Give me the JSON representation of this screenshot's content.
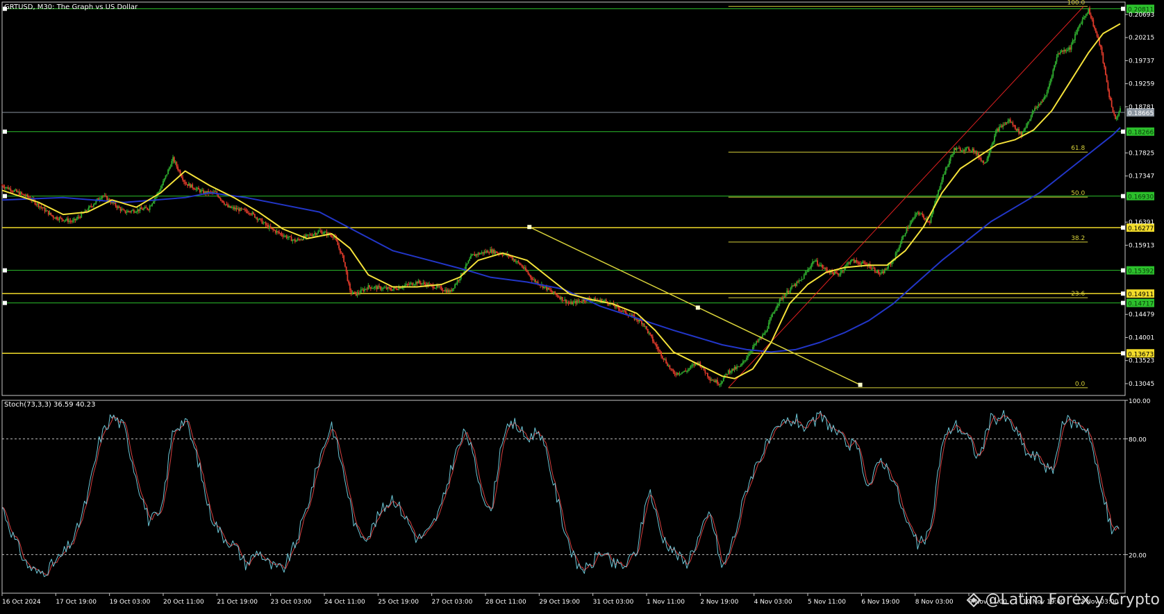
{
  "window_title": "GRTUSD, M30:  The Graph vs US Dollar",
  "stoch_title": "Stoch(73,3,3) 36.59 40.23",
  "watermark": "@Latim Forex y Crypto",
  "colors": {
    "background": "#000000",
    "frame": "#c8c8c8",
    "candle_up": "#2fae2f",
    "candle_down": "#e23b2b",
    "ma_fast": "#f5e23a",
    "ma_slow": "#2236c8",
    "level_green": "#2cc02c",
    "level_yellow": "#f2dc2a",
    "bid_line": "#8c96a0",
    "fib": "#d8d23a",
    "fib_trend": "#e02020",
    "trendline": "#d8d23a",
    "stoch_main": "#6cc8d8",
    "stoch_signal": "#d84040"
  },
  "chart_data": [
    {
      "type": "candlestick",
      "symbol": "GRTUSD",
      "timeframe": "M30",
      "ylim": [
        0.128,
        0.2095
      ],
      "y_ticks": [
        "0.20693",
        "0.20215",
        "0.19737",
        "0.19259",
        "0.18781",
        "0.17825",
        "0.17347",
        "0.16391",
        "0.15913",
        "0.14479",
        "0.14001",
        "0.13523",
        "0.13045"
      ],
      "x_ticks": [
        "16 Oct 2024",
        "17 Oct 19:00",
        "19 Oct 03:00",
        "20 Oct 11:00",
        "21 Oct 19:00",
        "23 Oct 03:00",
        "24 Oct 11:00",
        "25 Oct 19:00",
        "27 Oct 03:00",
        "28 Oct 11:00",
        "29 Oct 19:00",
        "31 Oct 03:00",
        "1 Nov 11:00",
        "2 Nov 19:00",
        "4 Nov 03:00",
        "5 Nov 11:00",
        "6 Nov 19:00",
        "8 Nov 03:00",
        "9 Nov 11:00",
        "10 Nov 19:00",
        "12 Nov 03:00"
      ],
      "price_path": [
        [
          0,
          0.1715
        ],
        [
          2.2,
          0.169
        ],
        [
          4.2,
          0.165
        ],
        [
          5.8,
          0.164
        ],
        [
          6.8,
          0.166
        ],
        [
          8.2,
          0.1695
        ],
        [
          10,
          0.166
        ],
        [
          12,
          0.1668
        ],
        [
          13,
          0.171
        ],
        [
          14,
          0.177
        ],
        [
          15,
          0.172
        ],
        [
          16.5,
          0.17
        ],
        [
          17.5,
          0.17
        ],
        [
          18.5,
          0.167
        ],
        [
          20.3,
          0.166
        ],
        [
          22,
          0.1625
        ],
        [
          24,
          0.16
        ],
        [
          25,
          0.161
        ],
        [
          26,
          0.162
        ],
        [
          27.2,
          0.161
        ],
        [
          28,
          0.156
        ],
        [
          28.5,
          0.1495
        ],
        [
          29,
          0.149
        ],
        [
          30,
          0.1505
        ],
        [
          32,
          0.15
        ],
        [
          34,
          0.1515
        ],
        [
          35.5,
          0.1505
        ],
        [
          36.7,
          0.1495
        ],
        [
          37.5,
          0.1525
        ],
        [
          38.5,
          0.157
        ],
        [
          40,
          0.158
        ],
        [
          41.5,
          0.157
        ],
        [
          42.5,
          0.155
        ],
        [
          43.5,
          0.152
        ],
        [
          45,
          0.1495
        ],
        [
          46.5,
          0.147
        ],
        [
          48,
          0.148
        ],
        [
          49.5,
          0.1475
        ],
        [
          50.5,
          0.146
        ],
        [
          51.5,
          0.1445
        ],
        [
          52.5,
          0.143
        ],
        [
          53.5,
          0.1385
        ],
        [
          55,
          0.1325
        ],
        [
          56,
          0.133
        ],
        [
          57,
          0.135
        ],
        [
          58,
          0.1315
        ],
        [
          58.8,
          0.1305
        ],
        [
          59.5,
          0.133
        ],
        [
          60.5,
          0.134
        ],
        [
          61.5,
          0.138
        ],
        [
          62.5,
          0.141
        ],
        [
          63.5,
          0.147
        ],
        [
          64.5,
          0.15
        ],
        [
          65.5,
          0.152
        ],
        [
          66.5,
          0.156
        ],
        [
          67.5,
          0.154
        ],
        [
          68.5,
          0.153
        ],
        [
          69.5,
          0.156
        ],
        [
          71,
          0.155
        ],
        [
          72,
          0.153
        ],
        [
          73,
          0.156
        ],
        [
          74,
          0.162
        ],
        [
          75,
          0.166
        ],
        [
          76,
          0.164
        ],
        [
          77,
          0.173
        ],
        [
          78,
          0.179
        ],
        [
          79.5,
          0.179
        ],
        [
          80.5,
          0.176
        ],
        [
          81.5,
          0.183
        ],
        [
          82.5,
          0.185
        ],
        [
          83.5,
          0.182
        ],
        [
          84.5,
          0.187
        ],
        [
          85.5,
          0.19
        ],
        [
          86.5,
          0.199
        ],
        [
          87.5,
          0.2
        ],
        [
          88.3,
          0.205
        ],
        [
          89,
          0.208
        ],
        [
          90,
          0.2
        ],
        [
          90.7,
          0.19
        ],
        [
          91.2,
          0.185
        ],
        [
          91.6,
          0.1875
        ]
      ],
      "ma_fast": {
        "period": "fast",
        "path": [
          [
            0,
            0.1705
          ],
          [
            3,
            0.168
          ],
          [
            5,
            0.1655
          ],
          [
            7,
            0.166
          ],
          [
            9,
            0.1685
          ],
          [
            11,
            0.167
          ],
          [
            13,
            0.17
          ],
          [
            15,
            0.1745
          ],
          [
            17,
            0.1715
          ],
          [
            19,
            0.169
          ],
          [
            21,
            0.166
          ],
          [
            23,
            0.1625
          ],
          [
            25,
            0.1605
          ],
          [
            27,
            0.1615
          ],
          [
            28.5,
            0.1585
          ],
          [
            30,
            0.153
          ],
          [
            32,
            0.1505
          ],
          [
            34,
            0.1505
          ],
          [
            36,
            0.151
          ],
          [
            37.5,
            0.1525
          ],
          [
            39,
            0.156
          ],
          [
            41,
            0.1575
          ],
          [
            43,
            0.156
          ],
          [
            45,
            0.152
          ],
          [
            46.5,
            0.149
          ],
          [
            48,
            0.148
          ],
          [
            50,
            0.147
          ],
          [
            52,
            0.145
          ],
          [
            53.5,
            0.1415
          ],
          [
            55,
            0.137
          ],
          [
            57,
            0.1345
          ],
          [
            59,
            0.132
          ],
          [
            60,
            0.1315
          ],
          [
            61.5,
            0.1335
          ],
          [
            63,
            0.139
          ],
          [
            64.5,
            0.147
          ],
          [
            66,
            0.151
          ],
          [
            67.5,
            0.1535
          ],
          [
            69,
            0.1545
          ],
          [
            71,
            0.155
          ],
          [
            72.5,
            0.155
          ],
          [
            74,
            0.158
          ],
          [
            75.5,
            0.163
          ],
          [
            77,
            0.17
          ],
          [
            78.5,
            0.175
          ],
          [
            80,
            0.1775
          ],
          [
            81.5,
            0.18
          ],
          [
            83,
            0.181
          ],
          [
            84.5,
            0.183
          ],
          [
            86,
            0.187
          ],
          [
            87.5,
            0.193
          ],
          [
            89,
            0.199
          ],
          [
            90.2,
            0.203
          ],
          [
            91.6,
            0.205
          ]
        ]
      },
      "ma_slow": {
        "period": "slow",
        "path": [
          [
            0,
            0.1685
          ],
          [
            5,
            0.169
          ],
          [
            10,
            0.168
          ],
          [
            15,
            0.169
          ],
          [
            17,
            0.17
          ],
          [
            20,
            0.169
          ],
          [
            23,
            0.1675
          ],
          [
            26,
            0.166
          ],
          [
            29,
            0.162
          ],
          [
            32,
            0.158
          ],
          [
            35,
            0.156
          ],
          [
            38,
            0.154
          ],
          [
            40,
            0.1525
          ],
          [
            43,
            0.1515
          ],
          [
            46,
            0.15
          ],
          [
            49,
            0.1465
          ],
          [
            52,
            0.144
          ],
          [
            55,
            0.1415
          ],
          [
            57,
            0.14
          ],
          [
            59,
            0.1385
          ],
          [
            61,
            0.1375
          ],
          [
            63,
            0.137
          ],
          [
            65,
            0.1375
          ],
          [
            67,
            0.139
          ],
          [
            69,
            0.141
          ],
          [
            71,
            0.1435
          ],
          [
            73,
            0.147
          ],
          [
            75,
            0.1515
          ],
          [
            77,
            0.156
          ],
          [
            79,
            0.16
          ],
          [
            81,
            0.164
          ],
          [
            83,
            0.167
          ],
          [
            85,
            0.17
          ],
          [
            87,
            0.174
          ],
          [
            89,
            0.178
          ],
          [
            91,
            0.182
          ],
          [
            91.6,
            0.1835
          ]
        ]
      },
      "horizontal_levels": [
        {
          "price": 0.20811,
          "label": "0.20811",
          "kind": "green"
        },
        {
          "price": 0.18266,
          "label": "0.18266",
          "kind": "green"
        },
        {
          "price": 0.1693,
          "label": "0.16930",
          "kind": "green"
        },
        {
          "price": 0.16277,
          "label": "0.16277",
          "kind": "yellow"
        },
        {
          "price": 0.15392,
          "label": "0.15392",
          "kind": "green"
        },
        {
          "price": 0.14911,
          "label": "0.14911",
          "kind": "yellow"
        },
        {
          "price": 0.14717,
          "label": "0.14717",
          "kind": "green"
        },
        {
          "price": 0.13673,
          "label": "0.13673",
          "kind": "yellow"
        }
      ],
      "bid": {
        "price": 0.18665,
        "label": "0.18665"
      },
      "fibonacci": {
        "x_range": [
          59.5,
          88.6
        ],
        "low": 0.1296,
        "high": 0.2086,
        "levels": [
          {
            "ratio": 1.0,
            "label": "100.0"
          },
          {
            "ratio": 0.618,
            "label": "61.8"
          },
          {
            "ratio": 0.5,
            "label": "50.0"
          },
          {
            "ratio": 0.382,
            "label": "38.2"
          },
          {
            "ratio": 0.236,
            "label": "23.6"
          },
          {
            "ratio": 0.0,
            "label": "0.0"
          }
        ]
      },
      "trendline": {
        "from": [
          43.2,
          0.1629
        ],
        "mid": [
          57.0,
          0.1462
        ],
        "to": [
          70.3,
          0.1302
        ]
      }
    },
    {
      "type": "line",
      "indicator": "Stochastic",
      "params": "73,3,3",
      "main": 36.59,
      "signal": 40.23,
      "ylim": [
        0,
        100
      ],
      "y_ticks": [
        "100.00",
        "80.00",
        "20.00"
      ],
      "levels": [
        80,
        20
      ],
      "path": [
        [
          0,
          45
        ],
        [
          1,
          28
        ],
        [
          2,
          15
        ],
        [
          3,
          10
        ],
        [
          4,
          14
        ],
        [
          5,
          20
        ],
        [
          6,
          30
        ],
        [
          7,
          50
        ],
        [
          8,
          80
        ],
        [
          9,
          92
        ],
        [
          10,
          86
        ],
        [
          11,
          60
        ],
        [
          12,
          38
        ],
        [
          13,
          40
        ],
        [
          14,
          85
        ],
        [
          15,
          90
        ],
        [
          16,
          70
        ],
        [
          17,
          42
        ],
        [
          18,
          30
        ],
        [
          19,
          25
        ],
        [
          20,
          15
        ],
        [
          21,
          22
        ],
        [
          22,
          14
        ],
        [
          23,
          12
        ],
        [
          24,
          25
        ],
        [
          25,
          45
        ],
        [
          26,
          70
        ],
        [
          27,
          88
        ],
        [
          28,
          62
        ],
        [
          29,
          32
        ],
        [
          30,
          30
        ],
        [
          31,
          42
        ],
        [
          32,
          50
        ],
        [
          33,
          40
        ],
        [
          34,
          28
        ],
        [
          35,
          32
        ],
        [
          36,
          45
        ],
        [
          37,
          70
        ],
        [
          38,
          85
        ],
        [
          39,
          60
        ],
        [
          40,
          40
        ],
        [
          41,
          82
        ],
        [
          42,
          88
        ],
        [
          43,
          80
        ],
        [
          44,
          85
        ],
        [
          45,
          62
        ],
        [
          46,
          35
        ],
        [
          47,
          15
        ],
        [
          48,
          12
        ],
        [
          49,
          22
        ],
        [
          50,
          15
        ],
        [
          51,
          14
        ],
        [
          52,
          22
        ],
        [
          53,
          55
        ],
        [
          54,
          30
        ],
        [
          55,
          22
        ],
        [
          56,
          15
        ],
        [
          57,
          28
        ],
        [
          58,
          42
        ],
        [
          59,
          12
        ],
        [
          60,
          30
        ],
        [
          61,
          55
        ],
        [
          62,
          70
        ],
        [
          63,
          80
        ],
        [
          64,
          88
        ],
        [
          65,
          90
        ],
        [
          66,
          85
        ],
        [
          67,
          92
        ],
        [
          68,
          86
        ],
        [
          69,
          78
        ],
        [
          70,
          76
        ],
        [
          71,
          55
        ],
        [
          72,
          70
        ],
        [
          73,
          60
        ],
        [
          74,
          38
        ],
        [
          75,
          25
        ],
        [
          76,
          30
        ],
        [
          77,
          78
        ],
        [
          78,
          88
        ],
        [
          79,
          82
        ],
        [
          80,
          70
        ],
        [
          81,
          90
        ],
        [
          82,
          92
        ],
        [
          83,
          85
        ],
        [
          84,
          72
        ],
        [
          85,
          70
        ],
        [
          86,
          62
        ],
        [
          87,
          90
        ],
        [
          88,
          88
        ],
        [
          89,
          85
        ],
        [
          90,
          55
        ],
        [
          91,
          30
        ],
        [
          91.6,
          36.6
        ]
      ]
    }
  ]
}
